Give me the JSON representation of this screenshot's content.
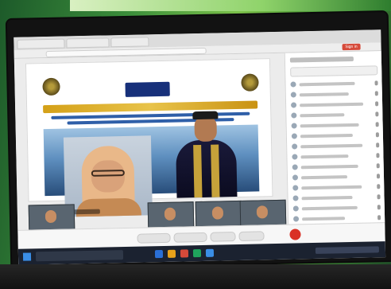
{
  "browser": {
    "sign_in_label": "Sign in"
  },
  "meeting": {
    "speaker_name_chip": "",
    "participants_header": "",
    "participants": [
      {
        "name": ""
      },
      {
        "name": ""
      },
      {
        "name": ""
      },
      {
        "name": ""
      },
      {
        "name": ""
      },
      {
        "name": ""
      },
      {
        "name": ""
      },
      {
        "name": ""
      },
      {
        "name": ""
      },
      {
        "name": ""
      },
      {
        "name": ""
      },
      {
        "name": ""
      },
      {
        "name": ""
      },
      {
        "name": ""
      }
    ]
  },
  "controls": {
    "mute_label": "",
    "video_label": "",
    "share_label": "",
    "more_label": ""
  },
  "colors": {
    "backdrop_green": "#3c8f3b",
    "leave_red": "#d93025",
    "slide_title_gold": "#d4a017",
    "taskbar": "#1b2230"
  },
  "icons": {
    "start": "windows-start-icon",
    "leave": "phone-hangup-icon",
    "mic": "microphone-icon",
    "camera": "camera-icon",
    "share": "screen-share-icon"
  }
}
